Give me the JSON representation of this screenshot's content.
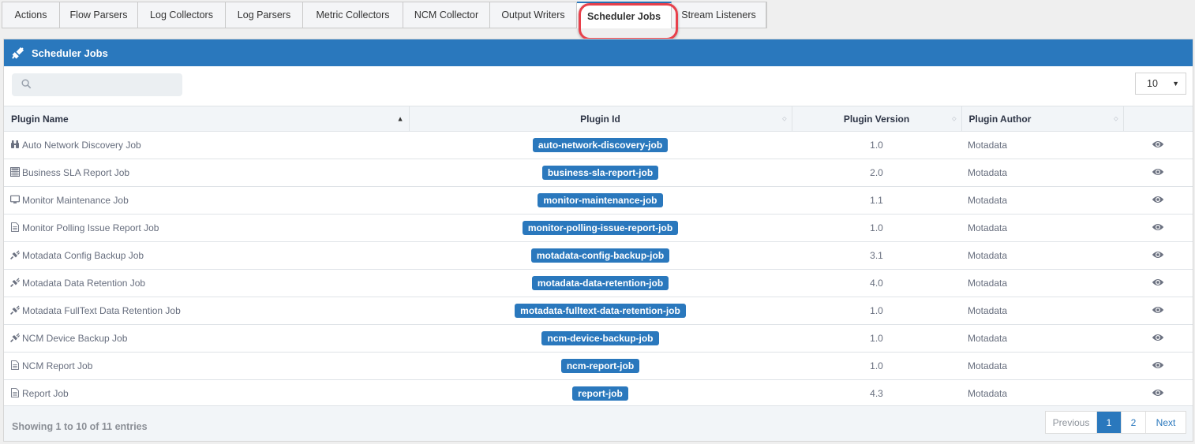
{
  "tabs": [
    {
      "label": "Actions",
      "active": false
    },
    {
      "label": "Flow Parsers",
      "active": false
    },
    {
      "label": "Log Collectors",
      "active": false
    },
    {
      "label": "Log Parsers",
      "active": false
    },
    {
      "label": "Metric Collectors",
      "active": false
    },
    {
      "label": "NCM Collector",
      "active": false
    },
    {
      "label": "Output Writers",
      "active": false
    },
    {
      "label": "Scheduler Jobs",
      "active": true
    },
    {
      "label": "Stream Listeners",
      "active": false
    }
  ],
  "panel": {
    "title": "Scheduler Jobs",
    "title_icon": "plug-icon",
    "accent_color": "#2a78bd"
  },
  "search": {
    "placeholder": "",
    "value": ""
  },
  "page_size": {
    "selected": "10"
  },
  "table": {
    "columns": [
      {
        "label": "Plugin Name",
        "sort": "asc"
      },
      {
        "label": "Plugin Id",
        "sort": "none"
      },
      {
        "label": "Plugin Version",
        "sort": "none"
      },
      {
        "label": "Plugin Author",
        "sort": "none"
      },
      {
        "label": "",
        "sort": "none"
      }
    ],
    "rows": [
      {
        "icon": "binoculars-icon",
        "name": "Auto Network Discovery Job",
        "id": "auto-network-discovery-job",
        "version": "1.0",
        "author": "Motadata"
      },
      {
        "icon": "calculator-icon",
        "name": "Business SLA Report Job",
        "id": "business-sla-report-job",
        "version": "2.0",
        "author": "Motadata"
      },
      {
        "icon": "monitor-icon",
        "name": "Monitor Maintenance Job",
        "id": "monitor-maintenance-job",
        "version": "1.1",
        "author": "Motadata"
      },
      {
        "icon": "document-icon",
        "name": "Monitor Polling Issue Report Job",
        "id": "monitor-polling-issue-report-job",
        "version": "1.0",
        "author": "Motadata"
      },
      {
        "icon": "plug-icon",
        "name": "Motadata Config Backup Job",
        "id": "motadata-config-backup-job",
        "version": "3.1",
        "author": "Motadata"
      },
      {
        "icon": "plug-icon",
        "name": "Motadata Data Retention Job",
        "id": "motadata-data-retention-job",
        "version": "4.0",
        "author": "Motadata"
      },
      {
        "icon": "plug-icon",
        "name": "Motadata FullText Data Retention Job",
        "id": "motadata-fulltext-data-retention-job",
        "version": "1.0",
        "author": "Motadata"
      },
      {
        "icon": "plug-icon",
        "name": "NCM Device Backup Job",
        "id": "ncm-device-backup-job",
        "version": "1.0",
        "author": "Motadata"
      },
      {
        "icon": "document-icon",
        "name": "NCM Report Job",
        "id": "ncm-report-job",
        "version": "1.0",
        "author": "Motadata"
      },
      {
        "icon": "document-icon",
        "name": "Report Job",
        "id": "report-job",
        "version": "4.3",
        "author": "Motadata"
      }
    ],
    "action_icon": "eye-icon"
  },
  "footer": {
    "info": "Showing 1 to 10 of 11 entries",
    "pagination": {
      "previous": "Previous",
      "pages": [
        "1",
        "2"
      ],
      "current": "1",
      "next": "Next"
    }
  }
}
